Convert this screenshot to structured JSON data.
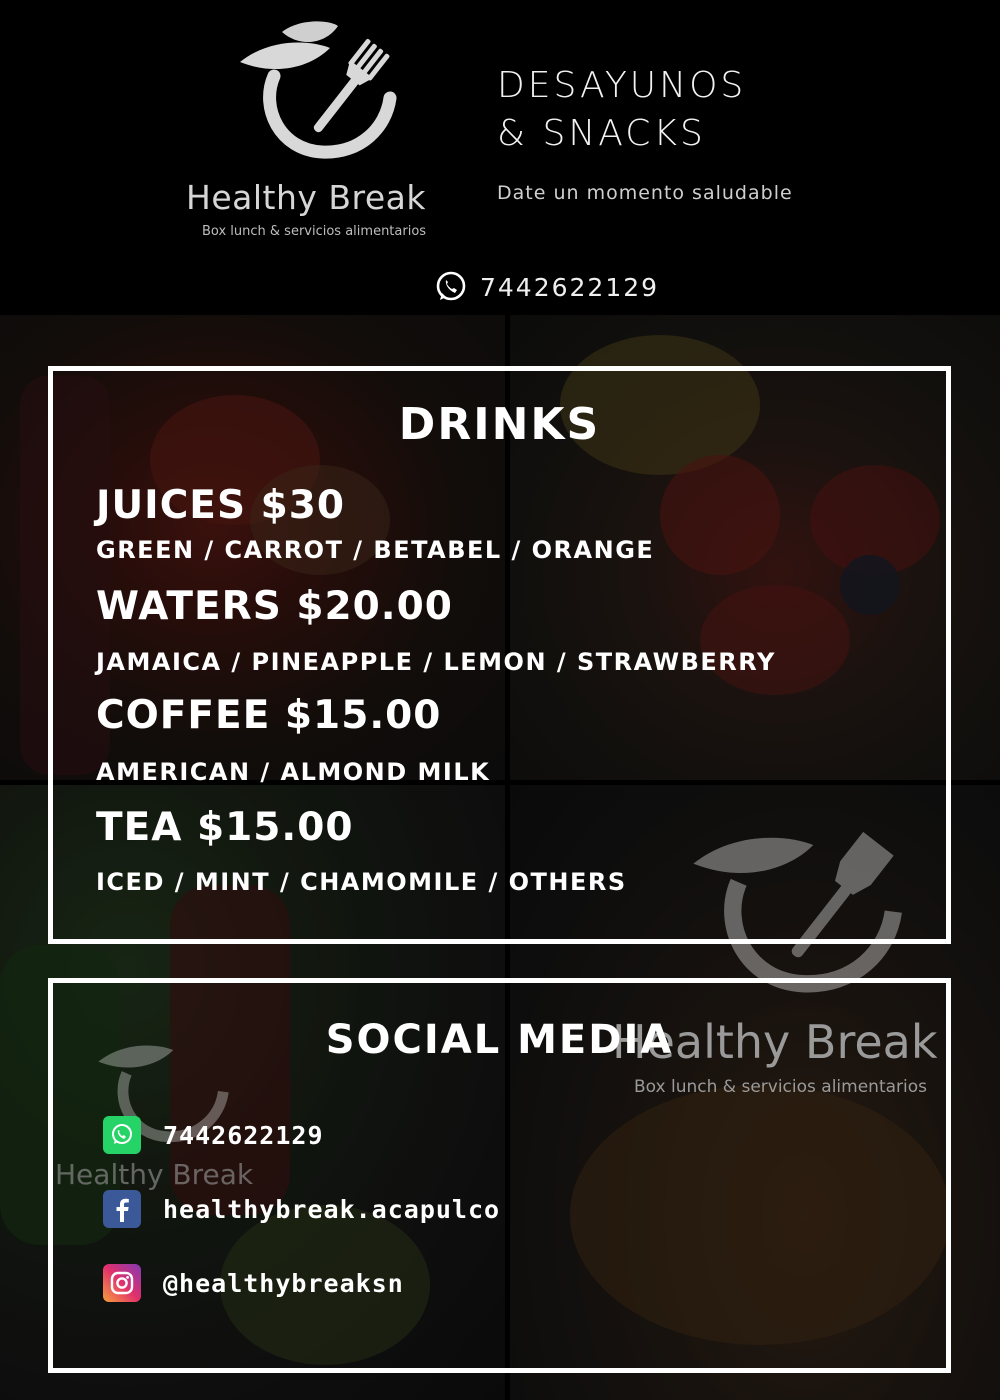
{
  "header": {
    "brand_name": "Healthy Break",
    "brand_tagline": "Box lunch & servicios alimentarios",
    "title_line1": "DESAYUNOS",
    "title_line2": "& SNACKS",
    "subtitle": "Date un momento saludable",
    "phone": "7442622129",
    "phone_icon": "whatsapp-icon"
  },
  "drinks": {
    "title": "DRINKS",
    "items": [
      {
        "name": "JUICES $30",
        "options": "GREEN / CARROT / BETABEL / ORANGE"
      },
      {
        "name": "WATERS $20.00",
        "options": "JAMAICA / PINEAPPLE / LEMON / STRAWBERRY"
      },
      {
        "name": "COFFEE $15.00",
        "options": "AMERICAN / ALMOND MILK"
      },
      {
        "name": "TEA $15.00",
        "options": "ICED / MINT / CHAMOMILE / OTHERS"
      }
    ]
  },
  "social": {
    "title": "SOCIAL MEDIA",
    "links": [
      {
        "icon": "whatsapp-icon",
        "text": "7442622129"
      },
      {
        "icon": "facebook-icon",
        "text": "healthybreak.acapulco"
      },
      {
        "icon": "instagram-icon",
        "text": "@healthybreaksn"
      }
    ]
  },
  "watermark": {
    "brand_name": "Healthy Break",
    "brand_tagline": "Box lunch & servicios alimentarios"
  },
  "colors": {
    "background": "#000000",
    "text": "#ffffff",
    "whatsapp": "#25d366",
    "facebook": "#3b5998"
  }
}
